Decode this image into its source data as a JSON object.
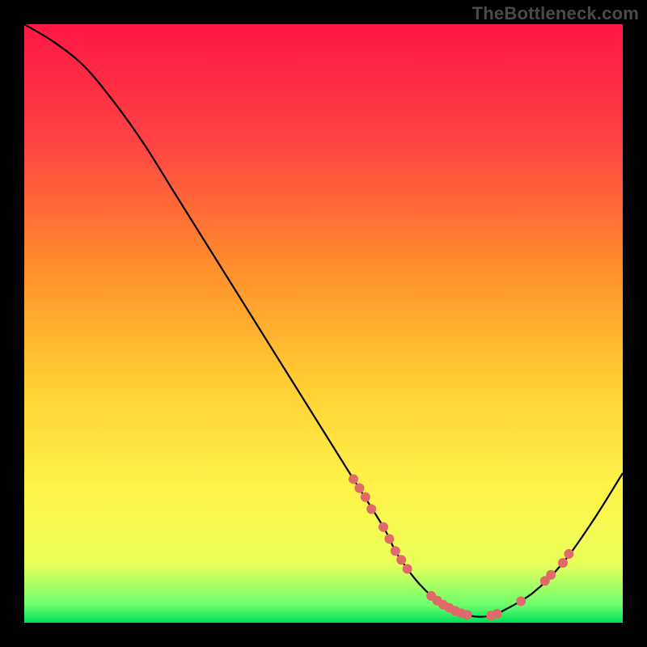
{
  "watermark": "TheBottleneck.com",
  "chart_data": {
    "type": "line",
    "title": "",
    "xlabel": "",
    "ylabel": "",
    "xlim": [
      0,
      100
    ],
    "ylim": [
      0,
      100
    ],
    "curve": {
      "x": [
        0,
        5,
        10,
        15,
        20,
        25,
        30,
        35,
        40,
        45,
        50,
        55,
        60,
        62,
        64,
        66,
        68,
        70,
        72,
        74,
        76,
        78,
        80,
        85,
        90,
        95,
        100
      ],
      "y": [
        100,
        97,
        93,
        87,
        80,
        72,
        64,
        56,
        48,
        40,
        32,
        24,
        16,
        12,
        9,
        6.5,
        4.5,
        3,
        2,
        1.3,
        1,
        1.2,
        2,
        5,
        10,
        17,
        25
      ]
    },
    "points": [
      {
        "x": 55,
        "y": 24
      },
      {
        "x": 56,
        "y": 22.5
      },
      {
        "x": 57,
        "y": 21
      },
      {
        "x": 58,
        "y": 19
      },
      {
        "x": 60,
        "y": 16
      },
      {
        "x": 61,
        "y": 14
      },
      {
        "x": 62,
        "y": 12
      },
      {
        "x": 63,
        "y": 10.5
      },
      {
        "x": 64,
        "y": 9
      },
      {
        "x": 68,
        "y": 4.5
      },
      {
        "x": 69,
        "y": 3.7
      },
      {
        "x": 70,
        "y": 3
      },
      {
        "x": 71,
        "y": 2.5
      },
      {
        "x": 72,
        "y": 2
      },
      {
        "x": 73,
        "y": 1.6
      },
      {
        "x": 74,
        "y": 1.3
      },
      {
        "x": 78,
        "y": 1.2
      },
      {
        "x": 79,
        "y": 1.5
      },
      {
        "x": 83,
        "y": 3.6
      },
      {
        "x": 87,
        "y": 7
      },
      {
        "x": 88,
        "y": 8
      },
      {
        "x": 90,
        "y": 10
      },
      {
        "x": 91,
        "y": 11.5
      }
    ],
    "gradient_bands": [
      {
        "stop": 0.0,
        "color": "#ff1744"
      },
      {
        "stop": 0.2,
        "color": "#ff4444"
      },
      {
        "stop": 0.4,
        "color": "#ff8c2b"
      },
      {
        "stop": 0.6,
        "color": "#ffcf33"
      },
      {
        "stop": 0.78,
        "color": "#fff44a"
      },
      {
        "stop": 0.9,
        "color": "#eaff5a"
      },
      {
        "stop": 0.97,
        "color": "#6dff6d"
      },
      {
        "stop": 1.0,
        "color": "#00e05a"
      }
    ],
    "point_color": "#e06a6a",
    "curve_color": "#000000"
  }
}
